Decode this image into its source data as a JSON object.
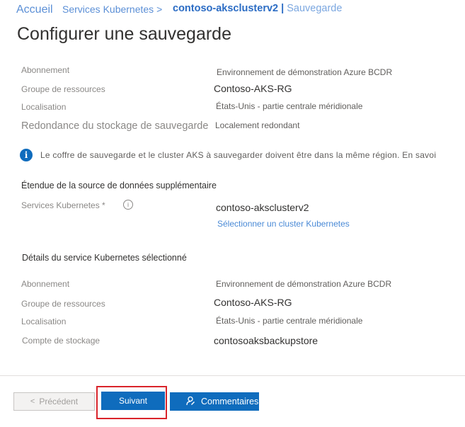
{
  "breadcrumb": {
    "home": "Accueil",
    "services": "Services Kubernetes >",
    "cluster": "contoso-aksclusterv2",
    "separator": "|",
    "page": "Sauvegarde"
  },
  "title": "Configurer une sauvegarde",
  "basics": {
    "subscription_label": "Abonnement",
    "subscription_value": "Environnement de démonstration Azure BCDR",
    "rg_label": "Groupe de ressources",
    "rg_value": "Contoso-AKS-RG",
    "location_label": "Localisation",
    "location_value": "États-Unis - partie centrale méridionale",
    "redundancy_label": "Redondance du stockage de sauvegarde",
    "redundancy_value": "Localement redondant"
  },
  "info": {
    "icon": "info-icon",
    "text": "Le coffre de sauvegarde et le cluster AKS à sauvegarder doivent être dans la même région. En savoi"
  },
  "datasource": {
    "heading": "Étendue de la source de données supplémentaire",
    "k8s_label": "Services Kubernetes *",
    "k8s_value": "contoso-aksclusterv2",
    "select_link": "Sélectionner un cluster Kubernetes"
  },
  "details": {
    "heading": "Détails du service Kubernetes sélectionné",
    "subscription_label": "Abonnement",
    "subscription_value": "Environnement de démonstration Azure BCDR",
    "rg_label": "Groupe de ressources",
    "rg_value": "Contoso-AKS-RG",
    "location_label": "Localisation",
    "location_value": "États-Unis - partie centrale méridionale",
    "storage_label": "Compte de stockage",
    "storage_value": "contosoaksbackupstore"
  },
  "footer": {
    "prev_label": "Précédent",
    "prev_icon": "chevron-left-icon",
    "next_label": "Suivant",
    "feedback_label": "Commentaires",
    "feedback_icon": "feedback-icon"
  },
  "colors": {
    "accent": "#0f6cbd",
    "highlight": "#d9242b",
    "link": "#4a8ad6"
  }
}
